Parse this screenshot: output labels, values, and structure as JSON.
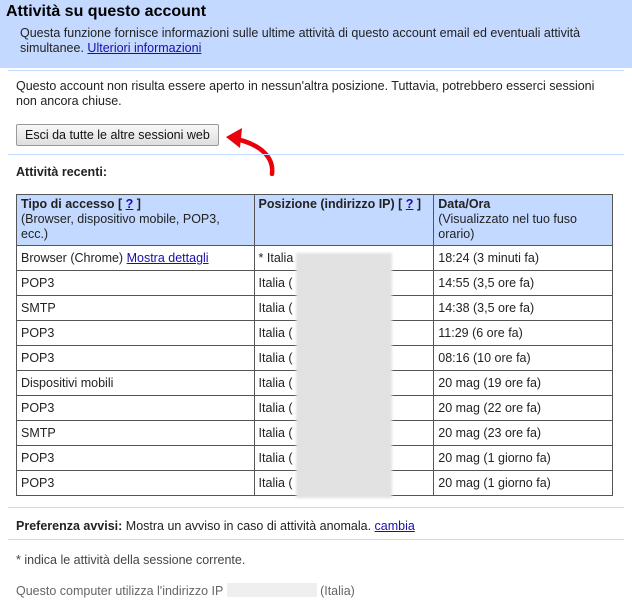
{
  "header": {
    "title": "Attività su questo account",
    "description": "Questa funzione fornisce informazioni sulle ultime attività di questo account email ed eventuali attività simultanee.",
    "more_info_link": "Ulteriori informazioni"
  },
  "notice": {
    "text": "Questo account non risulta essere aperto in nessun'altra posizione. Tuttavia, potrebbero esserci sessioni non ancora chiuse."
  },
  "signout_button": "Esci da tutte le altre sessioni web",
  "recent": {
    "label": "Attività recenti:",
    "columns": {
      "access_type": "Tipo di accesso",
      "access_type_help": "?",
      "access_type_sub": "(Browser, dispositivo mobile, POP3, ecc.)",
      "location": "Posizione (indirizzo IP)",
      "location_help": "?",
      "datetime": "Data/Ora",
      "datetime_sub": "(Visualizzato nel tuo fuso orario)"
    },
    "rows": [
      {
        "type": "Browser (Chrome)",
        "details_link": "Mostra dettagli",
        "location": "* Italia",
        "time": "18:24 (3 minuti fa)"
      },
      {
        "type": "POP3",
        "details_link": "",
        "location": "Italia (",
        "time": "14:55 (3,5 ore fa)"
      },
      {
        "type": "SMTP",
        "details_link": "",
        "location": "Italia (",
        "time": "14:38 (3,5 ore fa)"
      },
      {
        "type": "POP3",
        "details_link": "",
        "location": "Italia (",
        "time": "11:29 (6 ore fa)"
      },
      {
        "type": "POP3",
        "details_link": "",
        "location": "Italia (",
        "time": "08:16 (10 ore fa)"
      },
      {
        "type": "Dispositivi mobili",
        "details_link": "",
        "location": "Italia (",
        "time": "20 mag (19 ore fa)"
      },
      {
        "type": "POP3",
        "details_link": "",
        "location": "Italia (",
        "time": "20 mag (22 ore fa)"
      },
      {
        "type": "SMTP",
        "details_link": "",
        "location": "Italia (",
        "time": "20 mag (23 ore fa)"
      },
      {
        "type": "POP3",
        "details_link": "",
        "location": "Italia (",
        "time": "20 mag (1 giorno fa)"
      },
      {
        "type": "POP3",
        "details_link": "",
        "location": "Italia (",
        "time": "20 mag (1 giorno fa)"
      }
    ]
  },
  "alerts": {
    "label": "Preferenza avvisi:",
    "text": "Mostra un avviso in caso di attività anomala.",
    "change_link": "cambia"
  },
  "footnote": "* indica le attività della sessione corrente.",
  "ip_line": {
    "prefix": "Questo computer utilizza l'indirizzo IP",
    "suffix": "(Italia)"
  },
  "colors": {
    "header_bg": "#c3d9ff",
    "link": "#1a0dab",
    "arrow": "#e8000b"
  }
}
